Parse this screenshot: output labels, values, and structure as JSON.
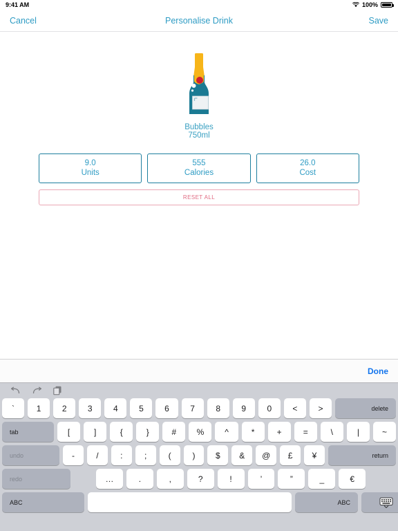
{
  "statusbar": {
    "time": "9:41 AM",
    "battery_percent": "100%",
    "wifi_icon": "wifi-icon",
    "battery_icon": "battery-icon"
  },
  "navbar": {
    "cancel_label": "Cancel",
    "title": "Personalise Drink",
    "save_label": "Save"
  },
  "drink": {
    "name": "Bubbles",
    "volume": "750ml",
    "icon": "champagne-bottle-icon",
    "colors": {
      "bottle_body": "#1a7a93",
      "bottle_foil": "#f7b519",
      "bottle_cap": "#cf2030",
      "label": "#e9eef1"
    }
  },
  "stats": [
    {
      "value": "9.0",
      "label": "Units",
      "name": "units"
    },
    {
      "value": "555",
      "label": "Calories",
      "name": "calories"
    },
    {
      "value": "26.0",
      "label": "Cost",
      "name": "cost"
    }
  ],
  "reset": {
    "label": "RESET ALL",
    "color": "#e06b82"
  },
  "accessory": {
    "done_label": "Done",
    "done_color": "#1274ed"
  },
  "keyboard": {
    "tools": [
      "undo-icon",
      "redo-icon",
      "paste-icon"
    ],
    "row1": [
      "`",
      "1",
      "2",
      "3",
      "4",
      "5",
      "6",
      "7",
      "8",
      "9",
      "0",
      "<",
      ">"
    ],
    "row1_action": "delete",
    "row2_action": "tab",
    "row2": [
      "[",
      "]",
      "{",
      "}",
      "#",
      "%",
      "^",
      "*",
      "+",
      "=",
      "\\",
      "|",
      "~"
    ],
    "row3_action": "undo",
    "row3": [
      "-",
      "/",
      ":",
      ";",
      "(",
      ")",
      "$",
      "&",
      "@",
      "£",
      "¥"
    ],
    "row3_return": "return",
    "row4_action": "redo",
    "row4": [
      "…",
      ".",
      ",",
      "?",
      "!",
      "’",
      "”",
      "_",
      "€"
    ],
    "row5": {
      "abc_left": "ABC",
      "space": "",
      "abc_right": "ABC",
      "dismiss": "dismiss-keyboard-icon"
    }
  },
  "theme": {
    "accent": "#2f9cc4",
    "border": "#1d7e9e",
    "keyboard_bg": "#ced0d6",
    "key_bg": "#ffffff",
    "key_dark_bg": "#aeb2bd"
  }
}
